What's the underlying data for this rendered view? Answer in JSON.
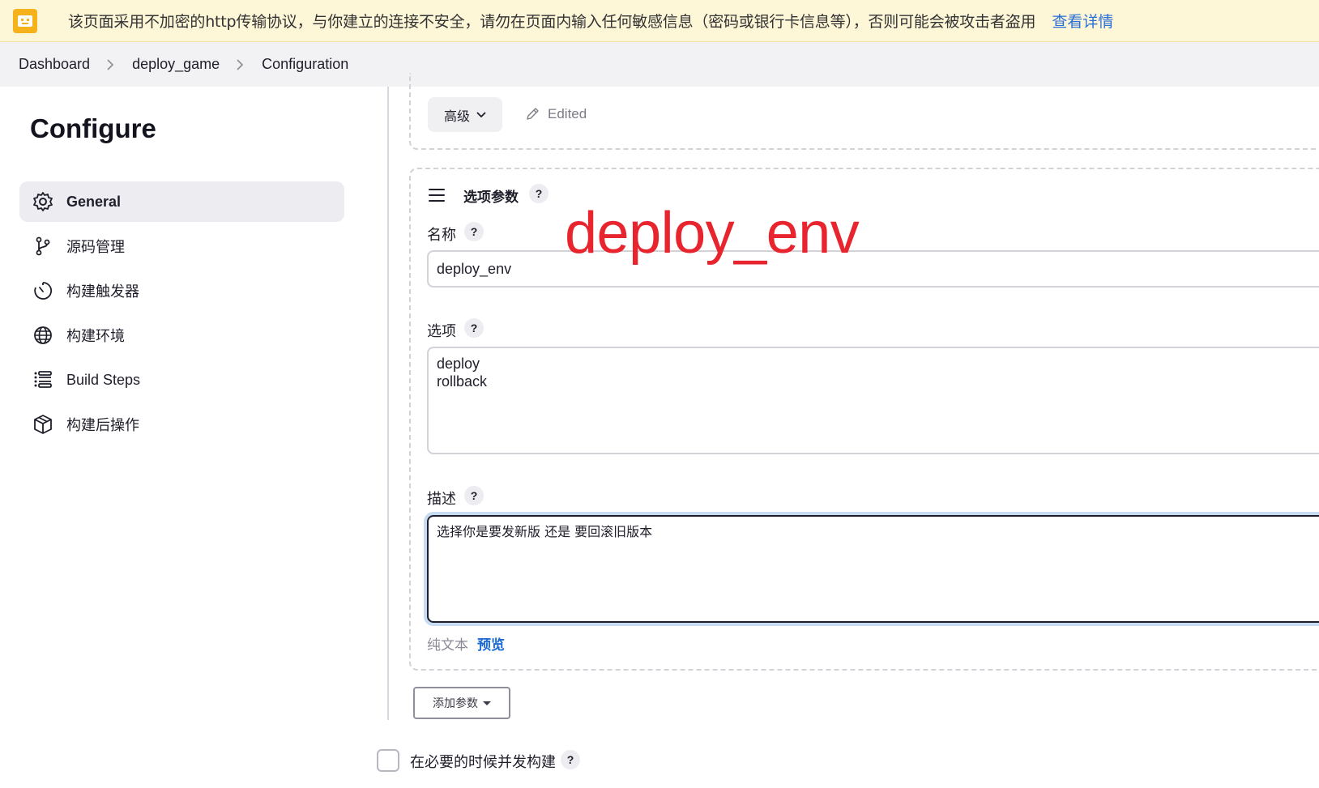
{
  "warning_bar": {
    "message": "该页面采用不加密的http传输协议，与你建立的连接不安全，请勿在页面内输入任何敏感信息（密码或银行卡信息等），否则可能会被攻击者盗用",
    "link": "查看详情",
    "icon": "browser-warning-icon",
    "color": "#fdf6d7"
  },
  "breadcrumb": {
    "items": [
      "Dashboard",
      "deploy_game",
      "Configuration"
    ]
  },
  "sidebar": {
    "title": "Configure",
    "items": [
      {
        "label": "General",
        "icon": "gear-icon",
        "active": true
      },
      {
        "label": "源码管理",
        "icon": "branch-icon"
      },
      {
        "label": "构建触发器",
        "icon": "timer-icon"
      },
      {
        "label": "构建环境",
        "icon": "globe-icon"
      },
      {
        "label": "Build Steps",
        "icon": "list-icon"
      },
      {
        "label": "构建后操作",
        "icon": "package-icon"
      }
    ]
  },
  "advanced": {
    "button_label": "高级",
    "edited_label": "Edited"
  },
  "choice_param": {
    "title": "选项参数",
    "name_label": "名称",
    "name_value": "deploy_env",
    "overlay_annotation": "deploy_env",
    "choices_label": "选项",
    "choices_value": "deploy\nrollback",
    "description_label": "描述",
    "description_value": "选择你是要发新版 还是 要回滚旧版本",
    "plain_text_label": "纯文本",
    "preview_label": "预览",
    "help": "?"
  },
  "add_param_button": "添加参数",
  "concurrent_build": {
    "label": "在必要的时候并发构建",
    "checked": false
  },
  "colors": {
    "accent_link": "#1a6bd6",
    "annotation_red": "#e8242e",
    "active_sidebar_bg": "#ececf1"
  }
}
